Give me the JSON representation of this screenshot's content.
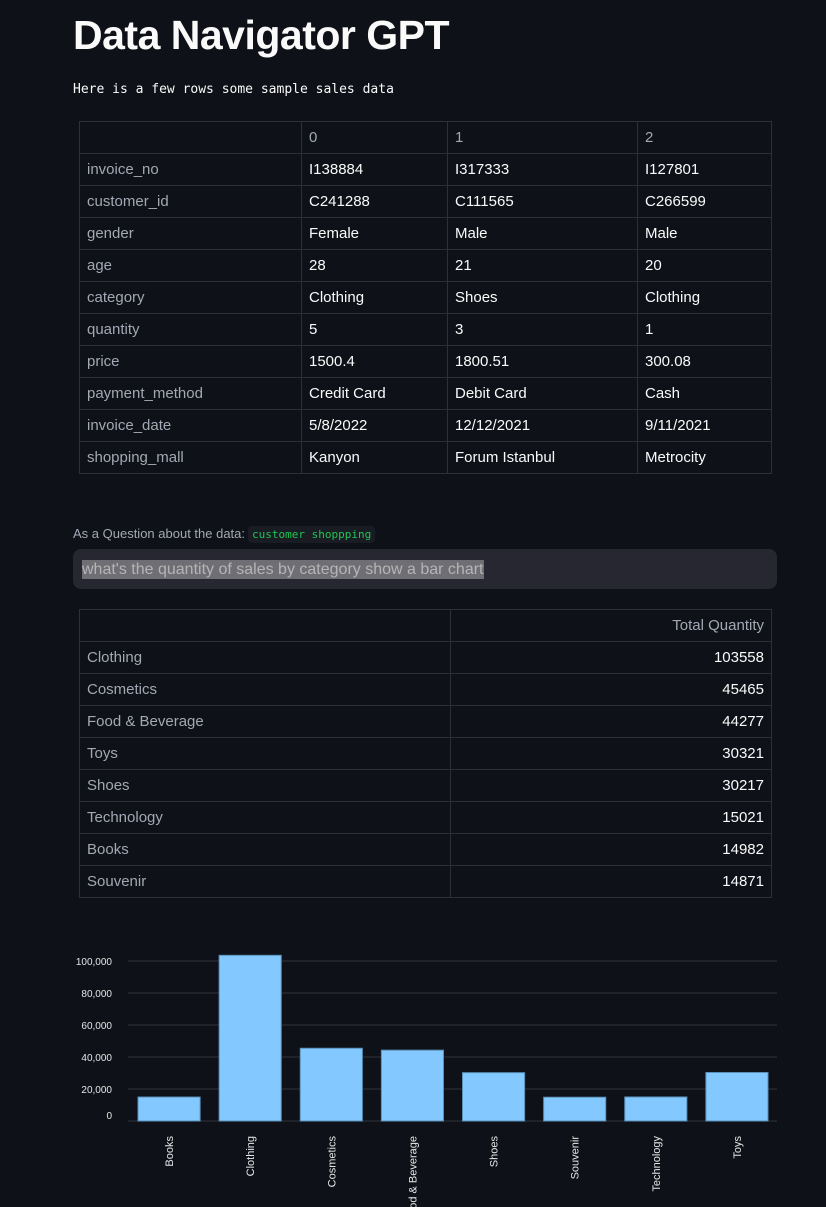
{
  "header": {
    "title": "Data Navigator GPT",
    "subtitle": "Here is a few rows some sample sales data"
  },
  "sample_table": {
    "columns": [
      "",
      "0",
      "1",
      "2"
    ],
    "rows": [
      [
        "invoice_no",
        "I138884",
        "I317333",
        "I127801"
      ],
      [
        "customer_id",
        "C241288",
        "C111565",
        "C266599"
      ],
      [
        "gender",
        "Female",
        "Male",
        "Male"
      ],
      [
        "age",
        "28",
        "21",
        "20"
      ],
      [
        "category",
        "Clothing",
        "Shoes",
        "Clothing"
      ],
      [
        "quantity",
        "5",
        "3",
        "1"
      ],
      [
        "price",
        "1500.4",
        "1800.51",
        "300.08"
      ],
      [
        "payment_method",
        "Credit Card",
        "Debit Card",
        "Cash"
      ],
      [
        "invoice_date",
        "5/8/2022",
        "12/12/2021",
        "9/11/2021"
      ],
      [
        "shopping_mall",
        "Kanyon",
        "Forum Istanbul",
        "Metrocity"
      ]
    ]
  },
  "question": {
    "label": "As a Question about the data:",
    "dataset": "customer shoppping",
    "value": "what's the quantity of sales by category show a bar chart"
  },
  "result_table": {
    "columns": [
      "",
      "Total Quantity"
    ],
    "rows": [
      [
        "Clothing",
        "103558"
      ],
      [
        "Cosmetics",
        "45465"
      ],
      [
        "Food & Beverage",
        "44277"
      ],
      [
        "Toys",
        "30321"
      ],
      [
        "Shoes",
        "30217"
      ],
      [
        "Technology",
        "15021"
      ],
      [
        "Books",
        "14982"
      ],
      [
        "Souvenir",
        "14871"
      ]
    ]
  },
  "chart_data": {
    "type": "bar",
    "categories": [
      "Books",
      "Clothing",
      "Cosmetics",
      "Food & Beverage",
      "Shoes",
      "Souvenir",
      "Technology",
      "Toys"
    ],
    "values": [
      14982,
      103558,
      45465,
      44277,
      30217,
      14871,
      15021,
      30321
    ],
    "yticks": [
      "0",
      "20,000",
      "40,000",
      "60,000",
      "80,000",
      "100,000"
    ],
    "ylim": [
      0,
      100000
    ],
    "grid": true,
    "bar_color": "#83c9ff"
  }
}
